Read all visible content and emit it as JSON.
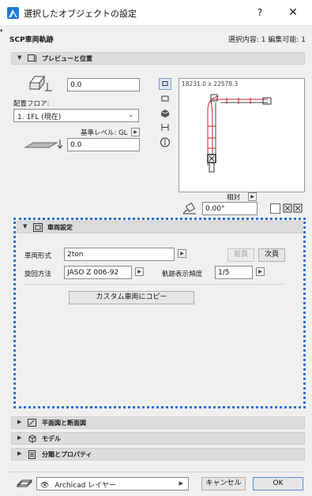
{
  "window": {
    "title": "選択したオブジェクトの設定",
    "help_label": "?",
    "close_label": "✕"
  },
  "header": {
    "object_name": "SCP車両軌跡",
    "selection_info": "選択内容: 1 編集可能: 1"
  },
  "preview_panel": {
    "title": "プレビューと位置",
    "height_value": "0.0",
    "floor_label": "配置フロア:",
    "floor_value": "1. 1FL (現在)",
    "base_level_label": "基準レベル: GL",
    "base_value": "0.0",
    "preview_dims": "18231.0 x 22578.3",
    "relative_label": "相対",
    "angle_value": "0.00°"
  },
  "vehicle_panel": {
    "title": "車両設定",
    "vehicle_type_label": "車両形式",
    "vehicle_type_value": "2ton",
    "prev_label": "前頁",
    "next_label": "次頁",
    "turning_method_label": "旋回方法",
    "turning_method_value": "JASO Z 006-92",
    "track_freq_label": "軌跡表示頻度",
    "track_freq_value": "1/5",
    "copy_button_label": "カスタム車両にコピー"
  },
  "collapsed_panels": [
    {
      "label": "平面図と断面図",
      "icon": "floor-plan-icon"
    },
    {
      "label": "モデル",
      "icon": "model-cube-icon"
    },
    {
      "label": "分類とプロパティ",
      "icon": "classification-icon"
    }
  ],
  "footer": {
    "layer_value": "Archicad レイヤー",
    "cancel_label": "キャンセル",
    "ok_label": "OK"
  },
  "colors": {
    "accent": "#2c6fcf",
    "panel_header": "#dcdcdc",
    "background": "#f0f0f0"
  }
}
